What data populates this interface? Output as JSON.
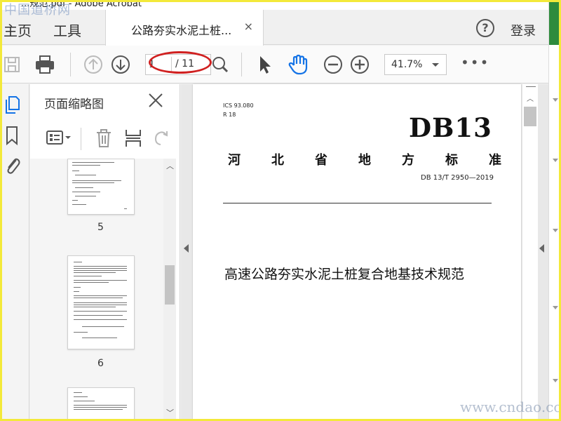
{
  "watermark_top": "中国道桥网",
  "watermark_bottom": "www.cndao.com",
  "titlebar_text": "...规范.pdf - Adobe Acrobat",
  "nav": {
    "home": "主页",
    "tools": "工具",
    "help_icon": "?",
    "login": "登录"
  },
  "tab": {
    "label": "公路夯实水泥土桩...",
    "close": "×"
  },
  "toolbar": {
    "page_current": "1",
    "page_total": "/ 11",
    "zoom": "41.7%",
    "more": "•••"
  },
  "thumbnails": {
    "title": "页面缩略图",
    "close": "×",
    "pages": [
      "5",
      "6"
    ]
  },
  "document": {
    "ics": "ICS 93.080",
    "r": "R 18",
    "db": "DB13",
    "province_chars": [
      "河",
      "北",
      "省",
      "地",
      "方",
      "标",
      "准"
    ],
    "code": "DB 13/T 2950—2019",
    "title": "高速公路夯实水泥土桩复合地基技术规范"
  },
  "colors": {
    "accent": "#1473e6",
    "annotation": "#d02020",
    "frame": "#f3e93a"
  },
  "icons": [
    "save-icon",
    "print-icon",
    "prev-page-icon",
    "next-page-icon",
    "zoom-search-icon",
    "select-arrow-icon",
    "hand-tool-icon",
    "zoom-out-icon",
    "zoom-in-icon",
    "page-thumbnails-icon",
    "bookmark-icon",
    "attachment-icon",
    "thumbnail-options-icon",
    "delete-icon",
    "extract-icon",
    "rotate-icon"
  ]
}
